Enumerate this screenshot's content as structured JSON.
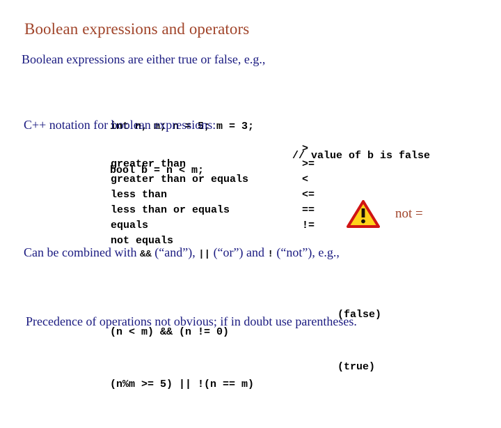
{
  "slide": {
    "title": "Boolean expressions and operators",
    "intro": "Boolean expressions are either true or false, e.g.,",
    "notation_heading": "C++ notation for boolean expressions:",
    "precedence_note": "Precedence of operations not obvious; if in doubt use parentheses."
  },
  "colors": {
    "title": "#a0442a",
    "body": "#1a1a80",
    "code": "#000000",
    "accent": "#a0442a",
    "warning_fill": "#ffd21a",
    "warning_border": "#d01414",
    "background": "#ffffff"
  },
  "code_block_1": {
    "lines": [
      {
        "text": "int n, m; n = 5; m = 3;",
        "comment": ""
      },
      {
        "text": "bool b = n < m;",
        "comment": "// value of b is false"
      }
    ]
  },
  "operator_table": {
    "rows": [
      {
        "name": "greater than",
        "symbol": ">"
      },
      {
        "name": "greater than or equals",
        "symbol": ">="
      },
      {
        "name": "less than",
        "symbol": "<"
      },
      {
        "name": "less than or equals",
        "symbol": "<="
      },
      {
        "name": "equals",
        "symbol": "=="
      },
      {
        "name": "not equals",
        "symbol": "!="
      }
    ]
  },
  "warning": {
    "icon": "warning-triangle-icon",
    "label": "not ="
  },
  "combine_line": {
    "part1": "Can be combined with ",
    "op_and": "&&",
    "part2": " (“and”), ",
    "op_or": "||",
    "part3": " (“or”) and ",
    "op_not": "!",
    "part4": " (“not”), e.g.,"
  },
  "code_block_2": {
    "lines": [
      {
        "expression": "(n < m) && (n != 0)",
        "result": "(false)"
      },
      {
        "expression": "(n%m >= 5) || !(n == m)",
        "result": "(true)"
      }
    ]
  }
}
